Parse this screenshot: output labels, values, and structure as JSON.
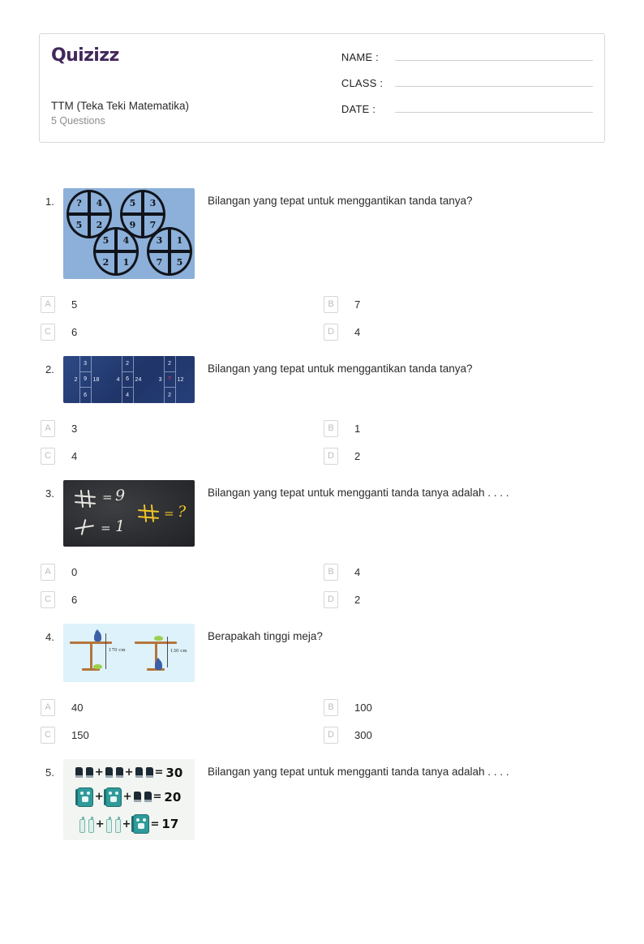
{
  "header": {
    "logo_text": "Quizizz",
    "quiz_title": "TTM (Teka Teki Matematika)",
    "question_count": "5 Questions",
    "fields": [
      {
        "label": "NAME :",
        "value": ""
      },
      {
        "label": "CLASS :",
        "value": ""
      },
      {
        "label": "DATE  :",
        "value": ""
      }
    ]
  },
  "colors": {
    "brand_purple": "#42285a",
    "muted_text": "#8d8d8d",
    "badge_border": "#d6d6d6",
    "q1_background": "#8cb0d9",
    "q2_background": "#27407a",
    "q3_background": "#2b2d30",
    "q4_background": "#ddf2fb",
    "q5_background": "#f2f5f1",
    "chalk_yellow": "#f2c327",
    "question_mark_red": "#c9314a"
  },
  "questions": [
    {
      "number": "1.",
      "text": "Bilangan yang tepat untuk menggantikan tanda tanya?",
      "image": {
        "type": "quadrant-circles",
        "circles": [
          {
            "tl": "?",
            "tr": "4",
            "bl": "5",
            "br": "2"
          },
          {
            "tl": "5",
            "tr": "3",
            "bl": "9",
            "br": "7"
          },
          {
            "tl": "5",
            "tr": "4",
            "bl": "2",
            "br": "1"
          },
          {
            "tl": "3",
            "tr": "1",
            "bl": "7",
            "br": "5"
          }
        ]
      },
      "options": [
        {
          "letter": "A",
          "text": "5"
        },
        {
          "letter": "B",
          "text": "7"
        },
        {
          "letter": "C",
          "text": "6"
        },
        {
          "letter": "D",
          "text": "4"
        }
      ]
    },
    {
      "number": "2.",
      "text": "Bilangan yang tepat untuk menggantikan tanda tanya?",
      "image": {
        "type": "number-cross-grid",
        "groups": [
          {
            "left": "2",
            "top": "3",
            "center": "9",
            "bottom": "6",
            "right": "18"
          },
          {
            "left": "4",
            "top": "2",
            "center": "6",
            "bottom": "4",
            "right": "24"
          },
          {
            "left": "3",
            "top": "2",
            "center": "?",
            "bottom": "2",
            "right": "12"
          }
        ]
      },
      "options": [
        {
          "letter": "A",
          "text": "3"
        },
        {
          "letter": "B",
          "text": "1"
        },
        {
          "letter": "C",
          "text": "4"
        },
        {
          "letter": "D",
          "text": "2"
        }
      ]
    },
    {
      "number": "3.",
      "text": "Bilangan yang tepat untuk mengganti tanda tanya adalah . . . .",
      "image": {
        "type": "chalkboard-equations",
        "lines": [
          {
            "symbol": "hash-grid-white",
            "equals": "=",
            "value": "9"
          },
          {
            "symbol": "cross-white",
            "equals": "=",
            "value": "1"
          },
          {
            "symbol": "hash-grid-yellow",
            "equals": "=",
            "value": "?"
          }
        ]
      },
      "options": [
        {
          "letter": "A",
          "text": "0"
        },
        {
          "letter": "B",
          "text": "4"
        },
        {
          "letter": "C",
          "text": "6"
        },
        {
          "letter": "D",
          "text": "2"
        }
      ]
    },
    {
      "number": "4.",
      "text": "Berapakah tinggi meja?",
      "image": {
        "type": "table-height-puzzle",
        "measurements": [
          "170 cm",
          "130 cm"
        ]
      },
      "options": [
        {
          "letter": "A",
          "text": "40"
        },
        {
          "letter": "B",
          "text": "100"
        },
        {
          "letter": "C",
          "text": "150"
        },
        {
          "letter": "D",
          "text": "300"
        }
      ]
    },
    {
      "number": "5.",
      "text": "Bilangan yang tepat untuk mengganti tanda tanya adalah . . . .",
      "image": {
        "type": "icon-equations",
        "equations": [
          {
            "items": [
              "boots",
              "boots",
              "boots"
            ],
            "result": "30"
          },
          {
            "items": [
              "backpack",
              "backpack",
              "boots"
            ],
            "result": "20"
          },
          {
            "items": [
              "bottles",
              "bottles",
              "backpack"
            ],
            "result": "17"
          }
        ],
        "plus": "+",
        "equals": "="
      },
      "options": []
    }
  ]
}
